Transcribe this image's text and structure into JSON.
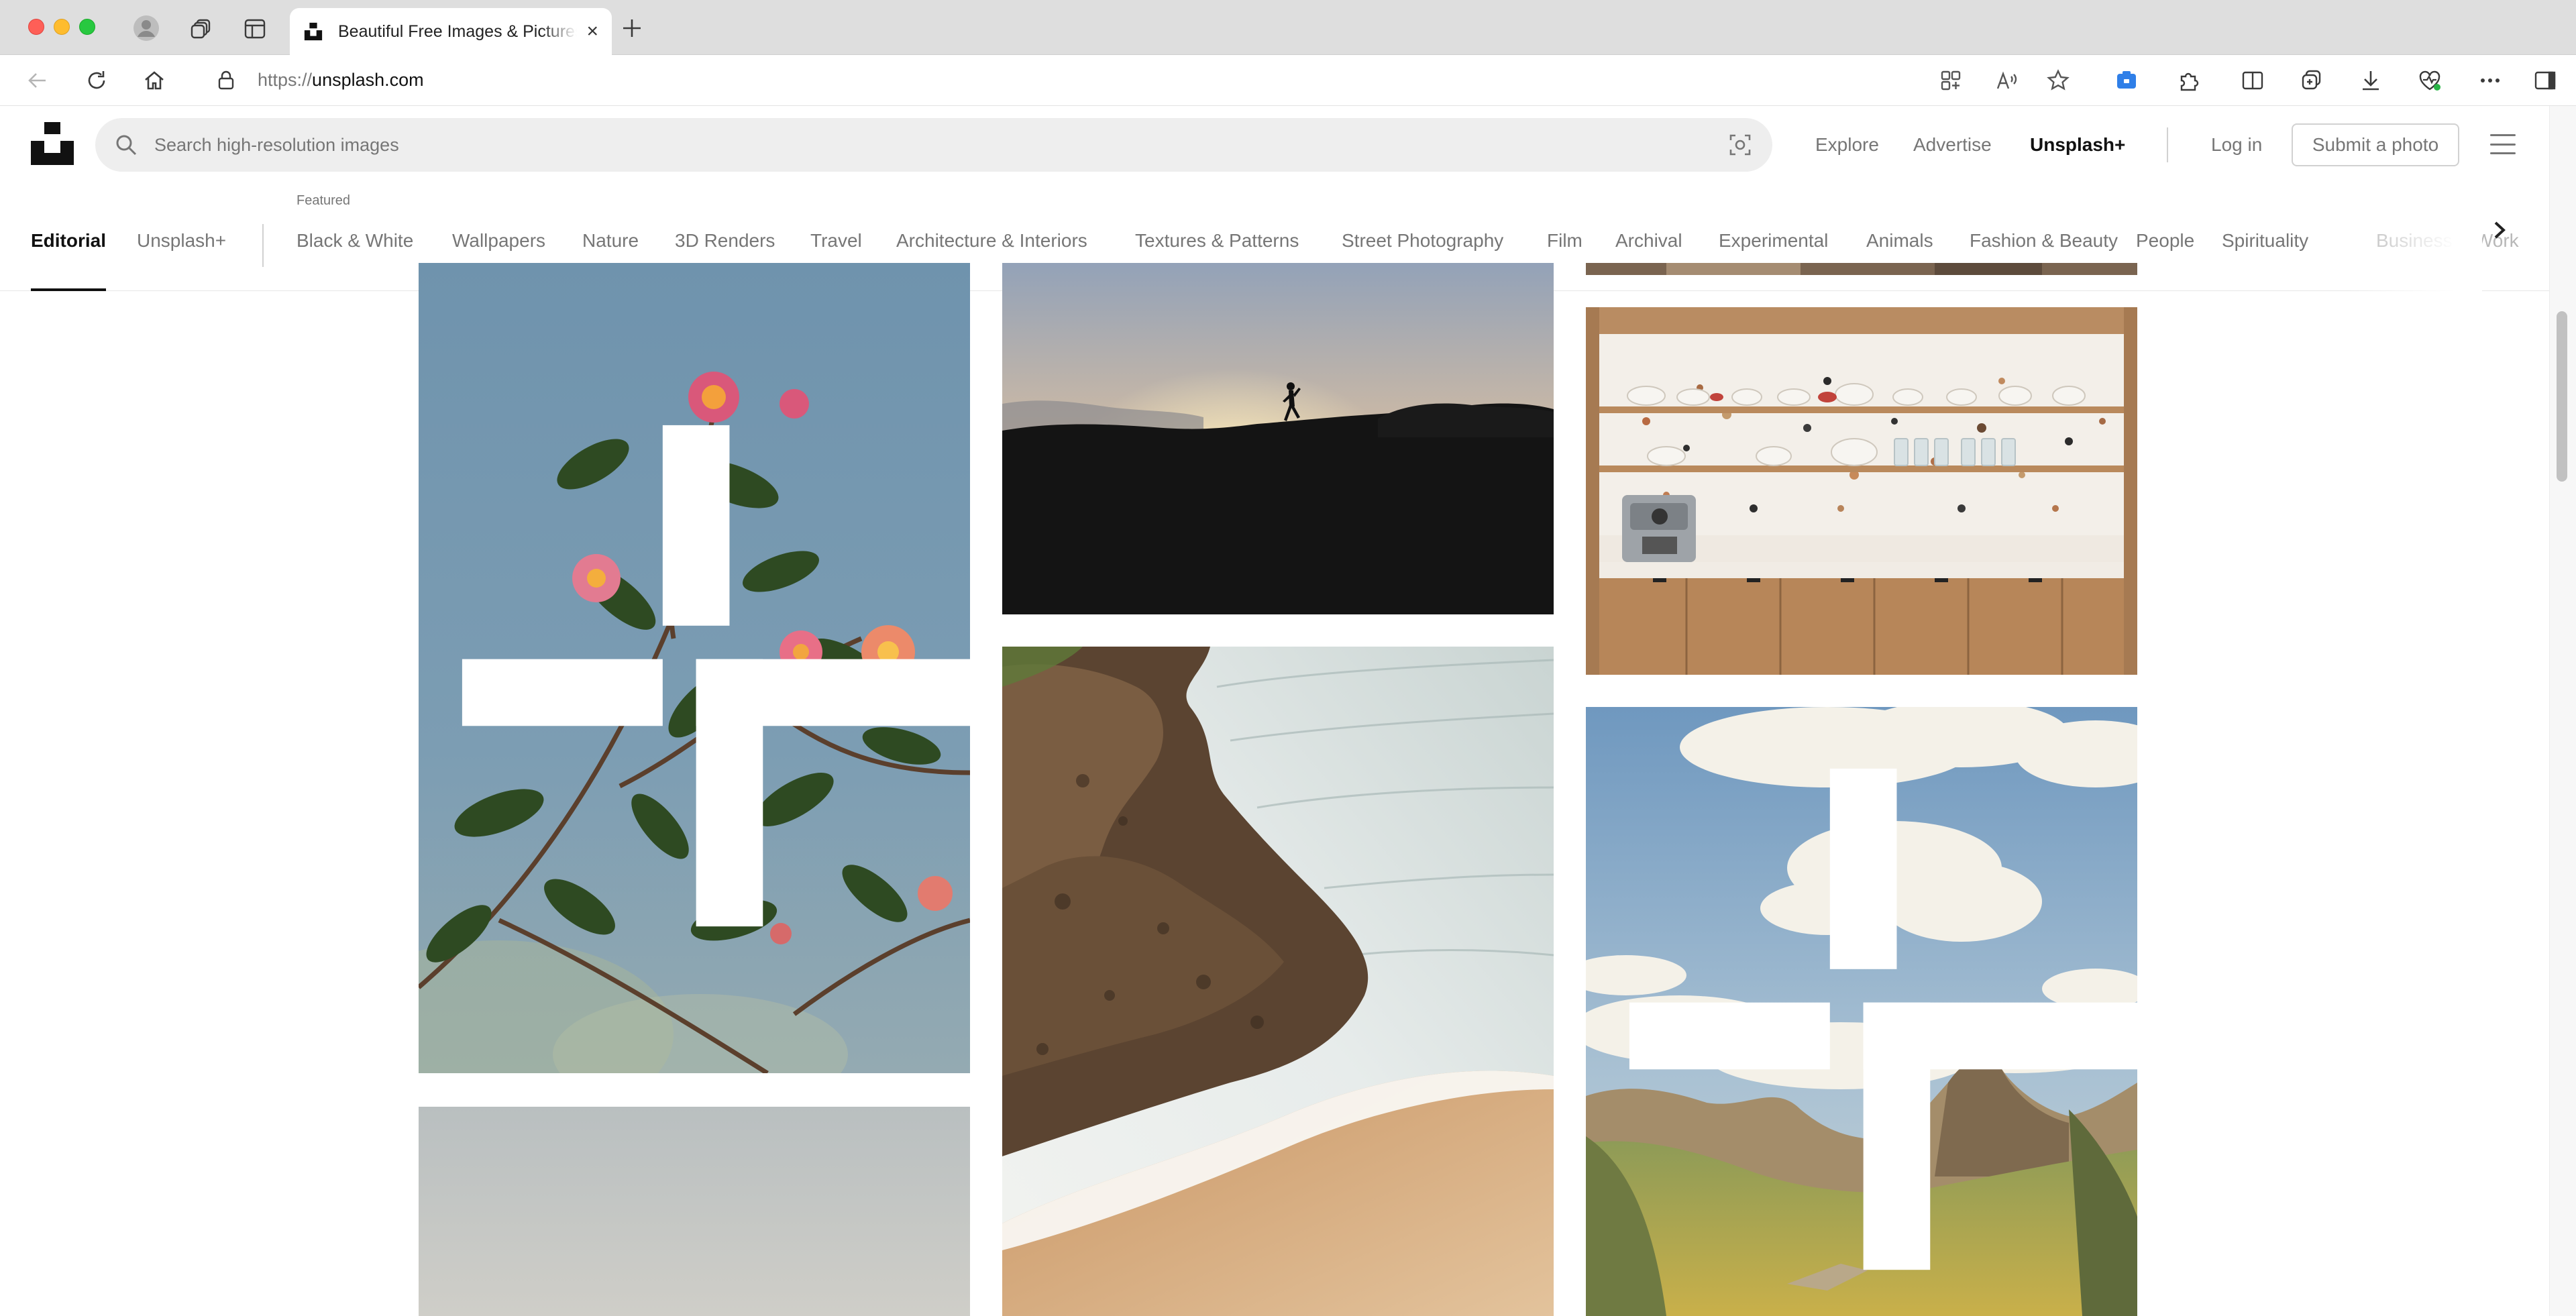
{
  "browser": {
    "tab_title": "Beautiful Free Images & Pictures | Unsplash",
    "url_protocol": "https://",
    "url_host": "unsplash.com"
  },
  "header": {
    "search_placeholder": "Search high-resolution images",
    "nav": {
      "explore": "Explore",
      "advertise": "Advertise",
      "unsplash_plus": "Unsplash+",
      "login": "Log in",
      "submit": "Submit a photo"
    }
  },
  "topics": {
    "featured_label": "Featured",
    "items": [
      "Editorial",
      "Unsplash+",
      "Black & White",
      "Wallpapers",
      "Nature",
      "3D Renders",
      "Travel",
      "Architecture & Interiors",
      "Textures & Patterns",
      "Street Photography",
      "Film",
      "Archival",
      "Experimental",
      "Animals",
      "Fashion & Beauty",
      "People",
      "Spirituality",
      "Business & Work"
    ],
    "active": "Editorial"
  },
  "photos": [
    {
      "id": "flowers",
      "premium": true,
      "subject": "pink lantana flowers against blue sky"
    },
    {
      "id": "sunset-runner",
      "premium": false,
      "subject": "silhouette runner at sunset on hill"
    },
    {
      "id": "coast",
      "premium": false,
      "subject": "rocky coastline with waves and sandy beach"
    },
    {
      "id": "kitchen",
      "premium": false,
      "subject": "terrazzo kitchen with open wooden shelves"
    },
    {
      "id": "mountains",
      "premium": true,
      "subject": "mountain valley under cloudy sky"
    },
    {
      "id": "haze",
      "premium": false,
      "subject": "hazy pale sky"
    },
    {
      "id": "top-strip",
      "premium": false,
      "subject": "partial photo strip"
    }
  ],
  "colors": {
    "accent": "#111111",
    "muted_text": "#767676",
    "search_bg": "#eeeeee"
  }
}
